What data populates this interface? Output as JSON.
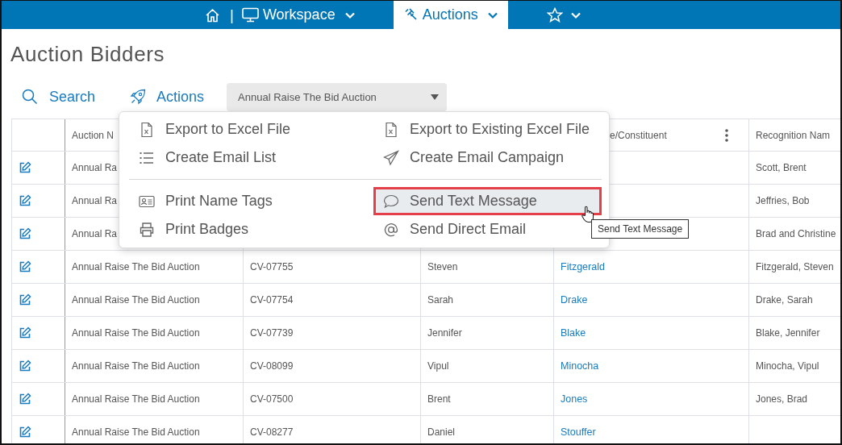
{
  "nav": {
    "separator": "|",
    "tabs": [
      {
        "label": "Workspace",
        "selected": false
      },
      {
        "label": "Auctions",
        "selected": true
      }
    ]
  },
  "page_title": "Auction Bidders",
  "toolbar": {
    "search": "Search",
    "actions": "Actions",
    "auction_select": {
      "value": "Annual Raise The Bid Auction"
    }
  },
  "table": {
    "header": {
      "auction": "Auction N",
      "last_name": "e/Constituent",
      "recognition": "Recognition Nam"
    },
    "rows": [
      {
        "auction": "Annual Ra",
        "recognition": "Scott, Brent"
      },
      {
        "auction": "Annual Ra",
        "recognition": "Jeffries, Bob"
      },
      {
        "auction": "Annual Ra",
        "recognition": "Brad and Christine"
      },
      {
        "auction": "Annual Raise The Bid Auction",
        "id": "CV-07755",
        "first_name": "Steven",
        "last_name": "Fitzgerald",
        "recognition": "Fitzgerald, Steven"
      },
      {
        "auction": "Annual Raise The Bid Auction",
        "id": "CV-07754",
        "first_name": "Sarah",
        "last_name": "Drake",
        "recognition": "Drake, Sarah"
      },
      {
        "auction": "Annual Raise The Bid Auction",
        "id": "CV-07739",
        "first_name": "Jennifer",
        "last_name": "Blake",
        "recognition": "Blake, Jennifer"
      },
      {
        "auction": "Annual Raise The Bid Auction",
        "id": "CV-08099",
        "first_name": "Vipul",
        "last_name": "Minocha",
        "recognition": "Minocha, Vipul"
      },
      {
        "auction": "Annual Raise The Bid Auction",
        "id": "CV-07500",
        "first_name": "Brent",
        "last_name": "Jones",
        "recognition": "Jones, Brad"
      },
      {
        "auction": "Annual Raise The Bid Auction",
        "id": "CV-08277",
        "first_name": "Daniel",
        "last_name": "Stouffer"
      }
    ]
  },
  "actions_menu": {
    "sections": [
      {
        "items": [
          {
            "label": "Export to Excel File",
            "selected": false
          },
          {
            "label": "Export to Existing Excel File",
            "selected": false
          },
          {
            "label": "Create Email List",
            "selected": false
          },
          {
            "label": "Create Email Campaign",
            "selected": false
          }
        ]
      },
      {
        "items": [
          {
            "label": "Print Name Tags",
            "selected": false
          },
          {
            "label": "Send Text Message",
            "selected": true
          },
          {
            "label": "Print Badges",
            "selected": false
          },
          {
            "label": "Send Direct Email",
            "selected": false
          }
        ]
      }
    ]
  },
  "tooltip": "Send Text Message"
}
